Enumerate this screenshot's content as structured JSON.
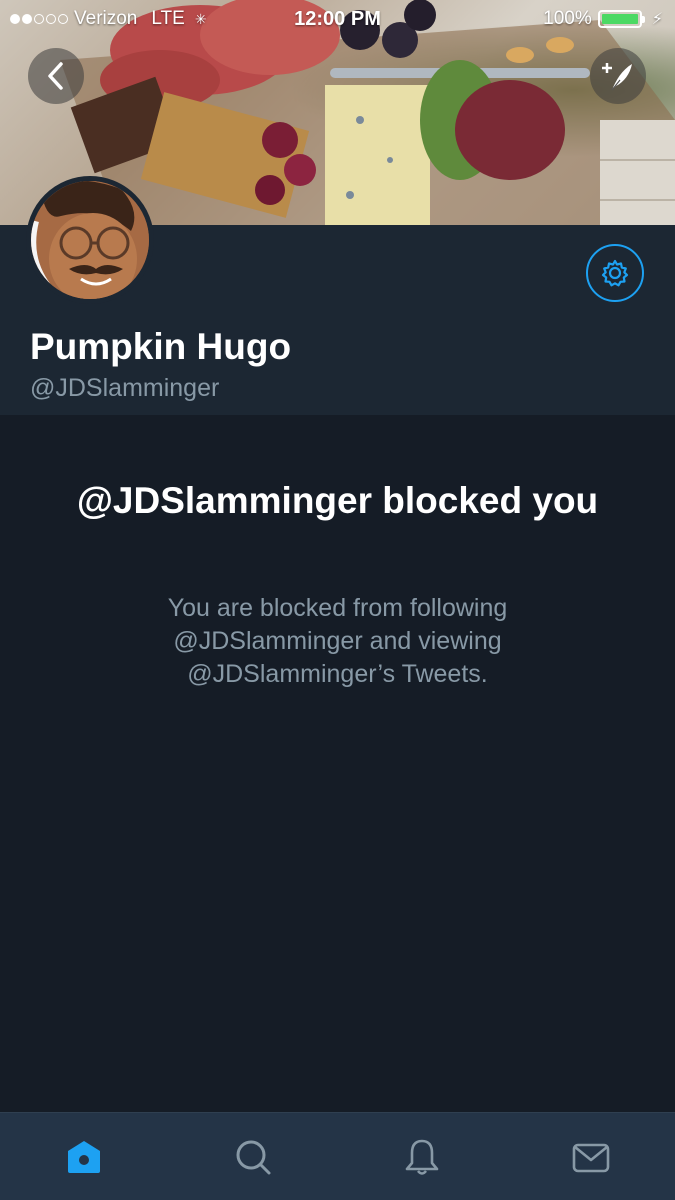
{
  "status_bar": {
    "carrier": "Verizon",
    "network": "LTE",
    "time": "12:00 PM",
    "battery": "100%",
    "battery_level": 1.0
  },
  "profile": {
    "display_name": "Pumpkin Hugo",
    "handle": "@JDSlamminger"
  },
  "blocked": {
    "title": "@JDSlamminger blocked you",
    "message": "You are blocked from following @JDSlamminger and viewing @JDSlamminger’s Tweets."
  },
  "tab_bar": {
    "tabs": [
      {
        "icon": "home-icon",
        "active": true
      },
      {
        "icon": "search-icon",
        "active": false
      },
      {
        "icon": "notifications-bell-icon",
        "active": false
      },
      {
        "icon": "messages-envelope-icon",
        "active": false
      }
    ]
  },
  "colors": {
    "accent": "#1da1f2",
    "background": "#151c26",
    "header_panel": "#1c2733",
    "secondary_text": "#8899a6",
    "tab_bar": "#243447"
  }
}
